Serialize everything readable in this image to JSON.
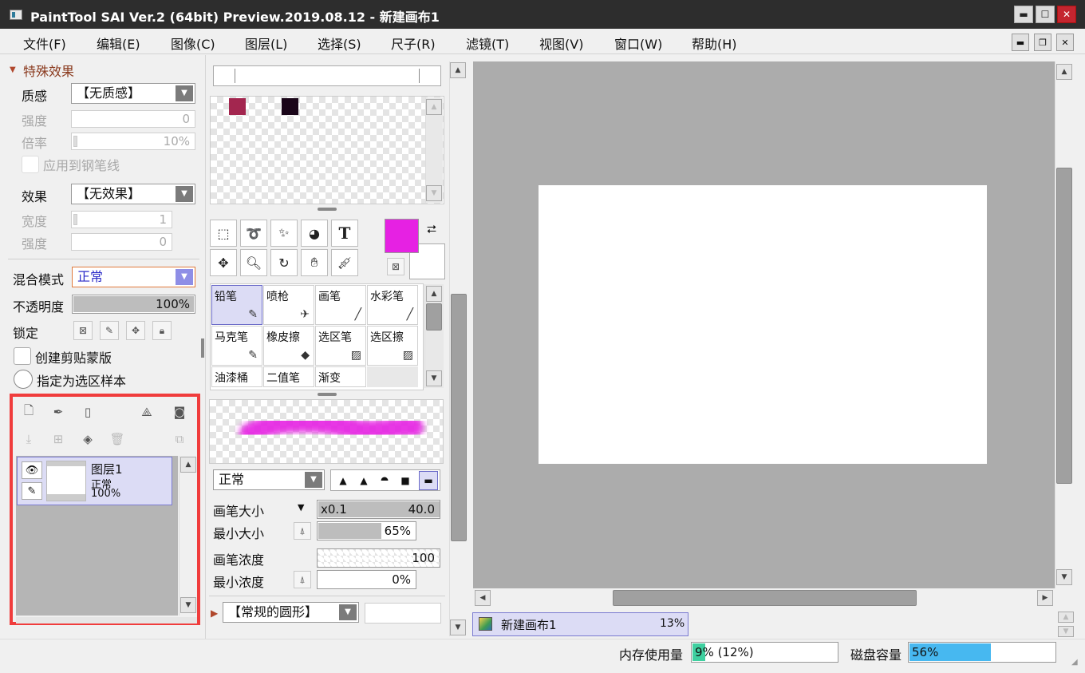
{
  "window": {
    "title": "PaintTool SAI Ver.2 (64bit) Preview.2019.08.12 - 新建画布1",
    "minimize": "▬",
    "maximize": "☐",
    "close": "✕"
  },
  "menu": [
    "文件(F)",
    "编辑(E)",
    "图像(C)",
    "图层(L)",
    "选择(S)",
    "尺子(R)",
    "滤镜(T)",
    "视图(V)",
    "窗口(W)",
    "帮助(H)"
  ],
  "mdi": {
    "minimize": "▬",
    "restore": "❐",
    "close": "✕"
  },
  "effects": {
    "section_title": "特殊效果",
    "texture_label": "质感",
    "texture_value": "【无质感】",
    "intensity_label": "强度",
    "intensity_value": "0",
    "scale_label": "倍率",
    "scale_value": "10%",
    "apply_pen_label": "应用到钢笔线",
    "effect_label": "效果",
    "effect_value": "【无效果】",
    "width_label": "宽度",
    "width_value": "1",
    "effect_intensity_label": "强度",
    "effect_intensity_value": "0"
  },
  "layer_props": {
    "blend_label": "混合模式",
    "blend_value": "正常",
    "opacity_label": "不透明度",
    "opacity_value": "100%",
    "opacity_fraction": 1.0,
    "lock_label": "锁定",
    "clipping_label": "创建剪贴蒙版",
    "selection_source_label": "指定为选区样本"
  },
  "layers": [
    {
      "name": "图层1",
      "mode": "正常",
      "opacity": "100%"
    }
  ],
  "colors": {
    "swatches": [
      "#a3264f",
      "#1a0519"
    ],
    "primary": "#e621e3",
    "secondary": "#ffffff",
    "highlight_box": "#f03c3c"
  },
  "tools": [
    {
      "label": "铅笔",
      "icon": "pencil-icon",
      "glyph": "✎",
      "selected": true
    },
    {
      "label": "喷枪",
      "icon": "airbrush-icon",
      "glyph": "✈",
      "selected": false
    },
    {
      "label": "画笔",
      "icon": "brush-icon",
      "glyph": "╱",
      "selected": false
    },
    {
      "label": "水彩笔",
      "icon": "watercolor-icon",
      "glyph": "╱",
      "selected": false
    },
    {
      "label": "马克笔",
      "icon": "marker-icon",
      "glyph": "✎",
      "selected": false
    },
    {
      "label": "橡皮擦",
      "icon": "eraser-icon",
      "glyph": "◆",
      "selected": false
    },
    {
      "label": "选区笔",
      "icon": "selpen-icon",
      "glyph": "▨",
      "selected": false
    },
    {
      "label": "选区擦",
      "icon": "selerase-icon",
      "glyph": "▨",
      "selected": false
    },
    {
      "label": "油漆桶",
      "icon": "bucket-icon",
      "glyph": "",
      "selected": false
    },
    {
      "label": "二值笔",
      "icon": "binary-pen-icon",
      "glyph": "",
      "selected": false
    },
    {
      "label": "渐变",
      "icon": "gradient-icon",
      "glyph": "",
      "selected": false
    }
  ],
  "brush": {
    "mode_value": "正常",
    "size_label": "画笔大小",
    "size_multiplier": "x0.1",
    "size_value": "40.0",
    "min_size_label": "最小大小",
    "min_size_value": "65%",
    "min_size_fraction": 0.65,
    "density_label": "画笔浓度",
    "density_value": "100",
    "min_density_label": "最小浓度",
    "min_density_value": "0%",
    "shape_value": "【常规的圆形】"
  },
  "document": {
    "name": "新建画布1",
    "zoom": "13%"
  },
  "status": {
    "memory_label": "内存使用量",
    "memory_value": "9% (12%)",
    "memory_fraction": 0.09,
    "disk_label": "磁盘容量",
    "disk_value": "56%",
    "disk_fraction": 0.56
  }
}
